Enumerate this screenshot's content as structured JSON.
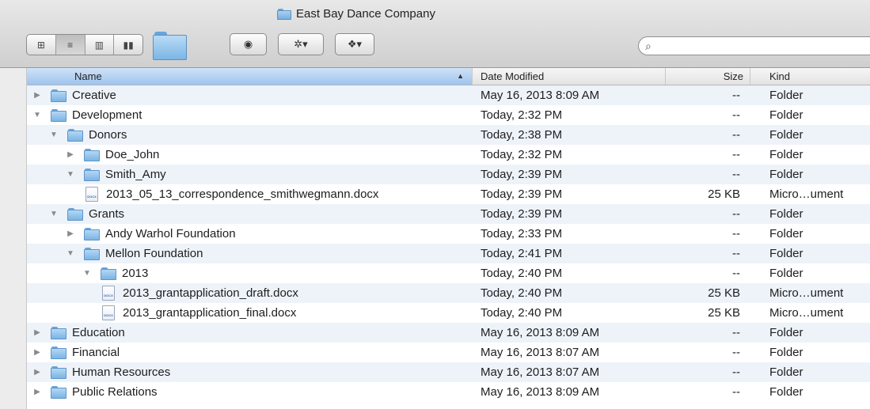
{
  "window": {
    "title": "East Bay Dance Company",
    "search": {
      "placeholder": "",
      "value": ""
    }
  },
  "toolbar": {
    "view_modes": [
      {
        "name": "icon-view",
        "glyph": "⊞"
      },
      {
        "name": "list-view",
        "glyph": "≡"
      },
      {
        "name": "column-view",
        "glyph": "▥"
      },
      {
        "name": "coverflow-view",
        "glyph": "▮▮"
      }
    ],
    "quicklook_glyph": "◉",
    "action_glyph": "✲▾",
    "dropbox_glyph": "❖▾"
  },
  "columns": {
    "name": "Name",
    "date": "Date Modified",
    "size": "Size",
    "kind": "Kind"
  },
  "rows": [
    {
      "depth": 0,
      "disclosure": "closed",
      "icon": "folder",
      "name": "Creative",
      "date": "May 16, 2013 8:09 AM",
      "size": "--",
      "kind": "Folder"
    },
    {
      "depth": 0,
      "disclosure": "open",
      "icon": "folder",
      "name": "Development",
      "date": "Today, 2:32 PM",
      "size": "--",
      "kind": "Folder"
    },
    {
      "depth": 1,
      "disclosure": "open",
      "icon": "folder",
      "name": "Donors",
      "date": "Today, 2:38 PM",
      "size": "--",
      "kind": "Folder"
    },
    {
      "depth": 2,
      "disclosure": "closed",
      "icon": "folder",
      "name": "Doe_John",
      "date": "Today, 2:32 PM",
      "size": "--",
      "kind": "Folder"
    },
    {
      "depth": 2,
      "disclosure": "open",
      "icon": "folder",
      "name": "Smith_Amy",
      "date": "Today, 2:39 PM",
      "size": "--",
      "kind": "Folder"
    },
    {
      "depth": 3,
      "disclosure": "none",
      "icon": "docx",
      "name": "2013_05_13_correspondence_smithwegmann.docx",
      "date": "Today, 2:39 PM",
      "size": "25 KB",
      "kind": "Micro…ument"
    },
    {
      "depth": 1,
      "disclosure": "open",
      "icon": "folder",
      "name": "Grants",
      "date": "Today, 2:39 PM",
      "size": "--",
      "kind": "Folder"
    },
    {
      "depth": 2,
      "disclosure": "closed",
      "icon": "folder",
      "name": "Andy Warhol Foundation",
      "date": "Today, 2:33 PM",
      "size": "--",
      "kind": "Folder"
    },
    {
      "depth": 2,
      "disclosure": "open",
      "icon": "folder",
      "name": "Mellon Foundation",
      "date": "Today, 2:41 PM",
      "size": "--",
      "kind": "Folder"
    },
    {
      "depth": 3,
      "disclosure": "open",
      "icon": "folder",
      "name": "2013",
      "date": "Today, 2:40 PM",
      "size": "--",
      "kind": "Folder"
    },
    {
      "depth": 4,
      "disclosure": "none",
      "icon": "docx",
      "name": "2013_grantapplication_draft.docx",
      "date": "Today, 2:40 PM",
      "size": "25 KB",
      "kind": "Micro…ument"
    },
    {
      "depth": 4,
      "disclosure": "none",
      "icon": "docx",
      "name": "2013_grantapplication_final.docx",
      "date": "Today, 2:40 PM",
      "size": "25 KB",
      "kind": "Micro…ument"
    },
    {
      "depth": 0,
      "disclosure": "closed",
      "icon": "folder",
      "name": "Education",
      "date": "May 16, 2013 8:09 AM",
      "size": "--",
      "kind": "Folder"
    },
    {
      "depth": 0,
      "disclosure": "closed",
      "icon": "folder",
      "name": "Financial",
      "date": "May 16, 2013 8:07 AM",
      "size": "--",
      "kind": "Folder"
    },
    {
      "depth": 0,
      "disclosure": "closed",
      "icon": "folder",
      "name": "Human Resources",
      "date": "May 16, 2013 8:07 AM",
      "size": "--",
      "kind": "Folder"
    },
    {
      "depth": 0,
      "disclosure": "closed",
      "icon": "folder",
      "name": "Public Relations",
      "date": "May 16, 2013 8:09 AM",
      "size": "--",
      "kind": "Folder"
    }
  ]
}
